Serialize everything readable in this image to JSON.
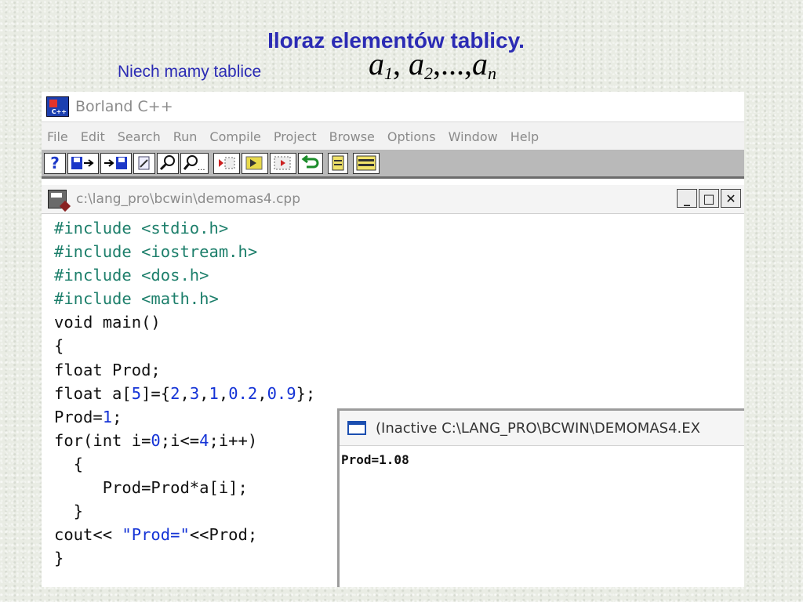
{
  "slide": {
    "title": "Iloraz elementów tablicy.",
    "subtitle": "Niech mamy tablice",
    "formula": {
      "base": "a",
      "sub1": "1",
      "sub2": "2",
      "subn": "n",
      "ellipsis": "...,"
    }
  },
  "ide": {
    "app_title": "Borland C++",
    "app_logo_text": "C++",
    "menu": [
      "File",
      "Edit",
      "Search",
      "Run",
      "Compile",
      "Project",
      "Browse",
      "Options",
      "Window",
      "Help"
    ],
    "toolbar_icons": [
      "help-icon",
      "save-to-file-icon",
      "load-from-file-icon",
      "edit-icon",
      "search-icon",
      "search-again-icon",
      "step-over-icon",
      "run-icon",
      "trace-into-icon",
      "undo-icon",
      "compile-icon",
      "make-icon"
    ],
    "toolbar_help_glyph": "?",
    "editor_title": "c:\\lang_pro\\bcwin\\demomas4.cpp",
    "window_buttons": {
      "minimize": "_",
      "maximize": "□",
      "close": "✕"
    },
    "code_lines": [
      "#include <stdio.h>",
      "#include <iostream.h>",
      "#include <dos.h>",
      "#include <math.h>",
      "void main()",
      "{",
      "float Prod;",
      "float a[5]={2,3,1,0.2,0.9};",
      "Prod=1;",
      "for(int i=0;i<=4;i++)",
      "  {",
      "     Prod=Prod*a[i];",
      "  }",
      "cout<< \"Prod=\"<<Prod;",
      "}"
    ]
  },
  "console": {
    "title": "(Inactive C:\\LANG_PRO\\BCWIN\\DEMOMAS4.EX",
    "output": "Prod=1.08"
  },
  "colors": {
    "title_blue": "#2b2bb4",
    "preprocessor": "#1d7f6b",
    "number_literal": "#1433d6",
    "toolbar_bg": "#b9b9b9"
  }
}
